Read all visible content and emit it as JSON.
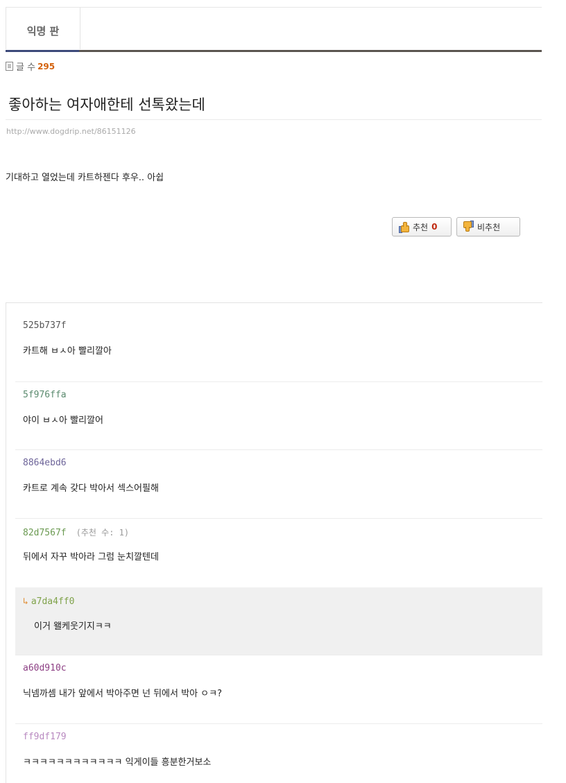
{
  "board": {
    "tab_label": "익명 판",
    "count_label": "글 수",
    "count_value": "295"
  },
  "post": {
    "title": "좋아하는 여자애한테 선톡왔는데",
    "url": "http://www.dogdrip.net/86151126",
    "body": "기대하고 열었는데 카트하젠다 후우.. 아쉽",
    "recommend_label": "추천",
    "recommend_count": "0",
    "unrecommend_label": "비추천"
  },
  "comments": [
    {
      "author": "525b737f",
      "color": "#555555",
      "text": "카트해 ㅂㅅ아 빨리깔아"
    },
    {
      "author": "5f976ffa",
      "color": "#5a8a6e",
      "text": "야이 ㅂㅅ아 빨리깔어"
    },
    {
      "author": "8864ebd6",
      "color": "#6d6499",
      "text": "카트로 계속 갖다 박아서 섹스어필해"
    },
    {
      "author": "82d7567f",
      "color": "#6b9a52",
      "votes": "(추천 수: 1)",
      "text": "뒤에서 자꾸 박아라 그럼 눈치깔텐데"
    },
    {
      "author": "a7da4ff0",
      "color": "#7fa24a",
      "reply": true,
      "text": "이거 왤케웃기지ㅋㅋ"
    },
    {
      "author": "a60d910c",
      "color": "#8c3e83",
      "text": "닉넴까셈 내가 앞에서 박아주면 넌 뒤에서 박아 ㅇㅋ?"
    },
    {
      "author": "ff9df179",
      "color": "#b889c0",
      "text": "ㅋㅋㅋㅋㅋㅋㅋㅋㅋㅋㅋㅋ 익게이들 흥분한거보소"
    }
  ]
}
